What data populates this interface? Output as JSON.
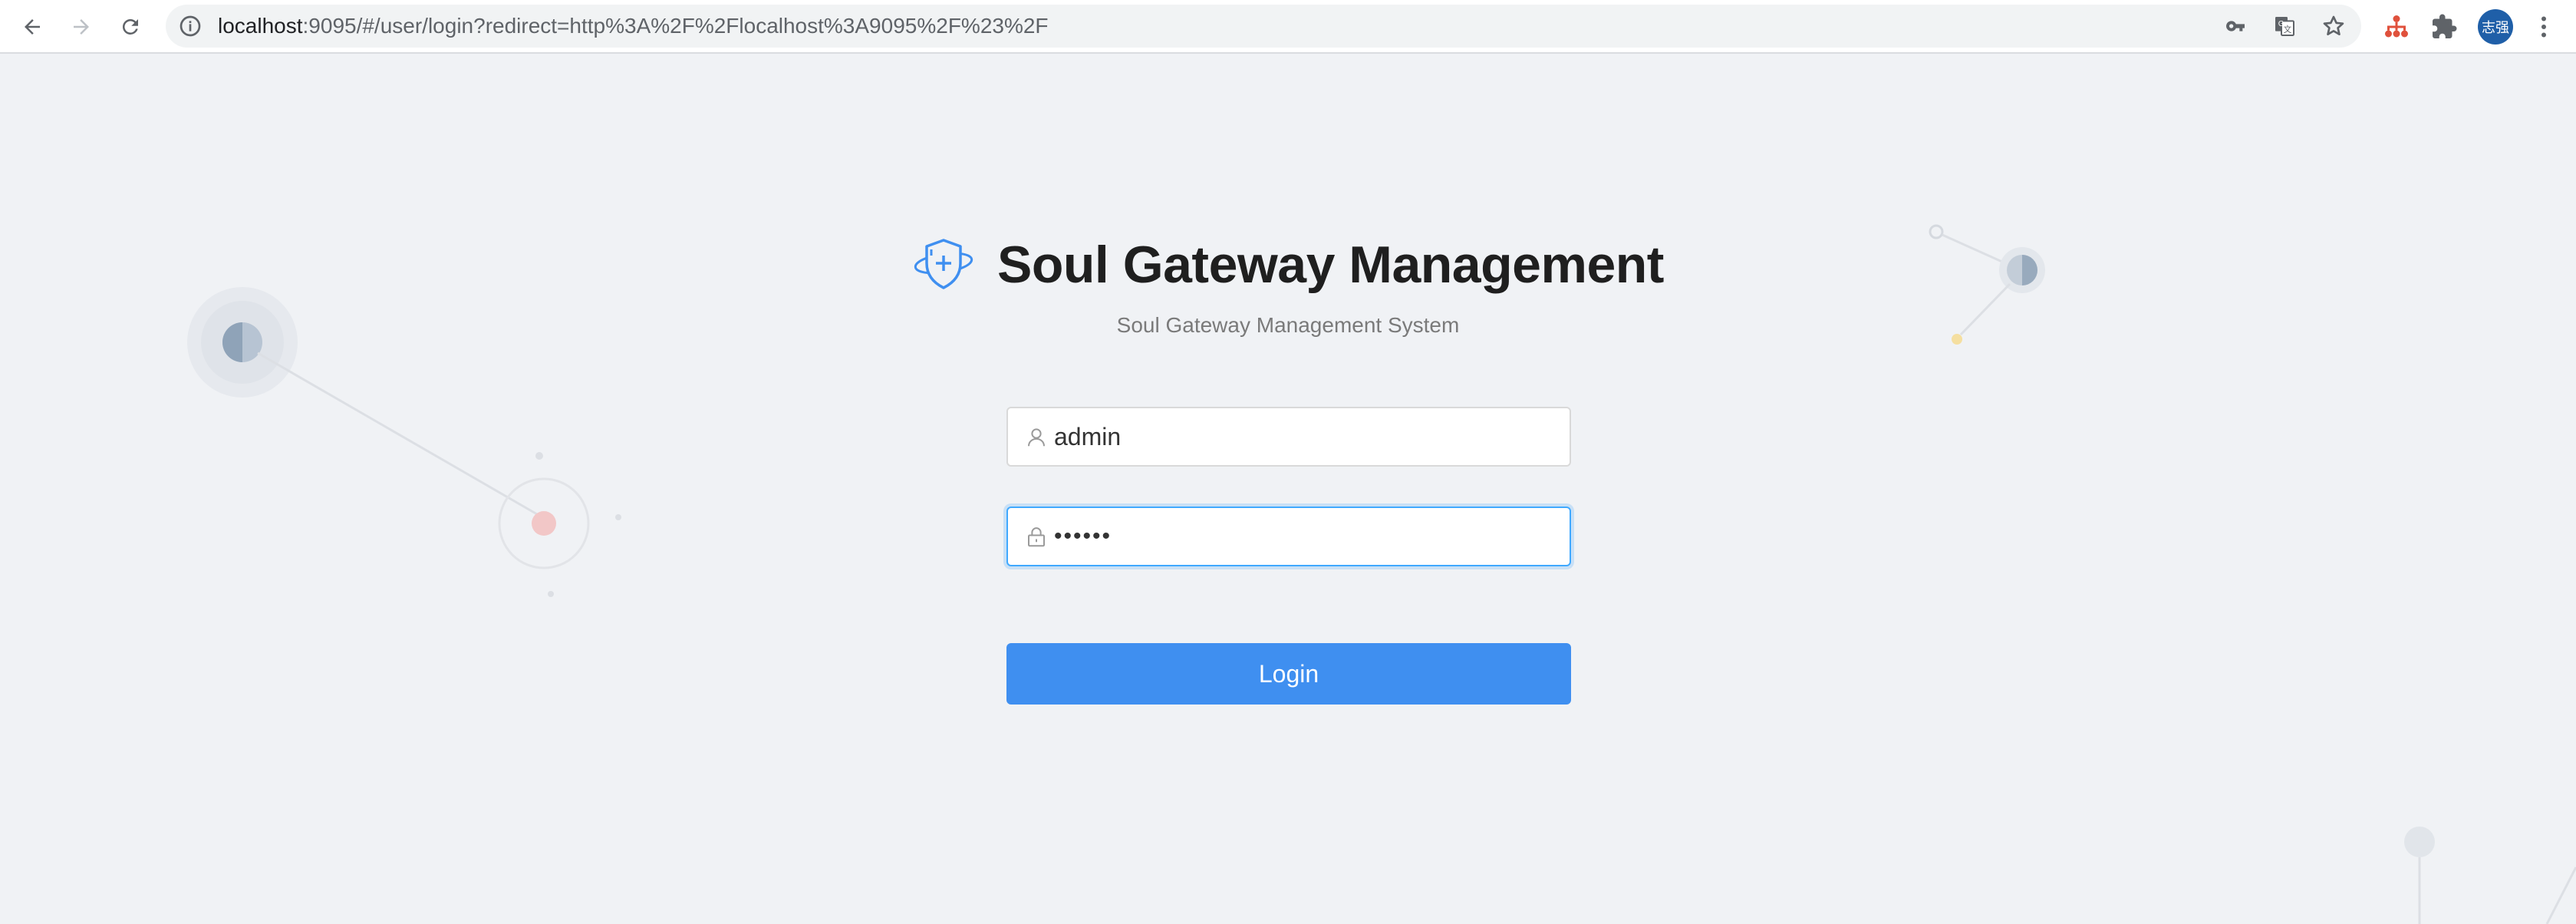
{
  "browser": {
    "url_host": "localhost",
    "url_rest": ":9095/#/user/login?redirect=http%3A%2F%2Flocalhost%3A9095%2F%23%2F",
    "avatar_text": "志强",
    "icons": [
      "back-arrow-icon",
      "forward-arrow-icon",
      "reload-icon",
      "site-info-icon",
      "key-icon",
      "translate-icon",
      "star-icon",
      "extension-hierarchy-icon",
      "puzzle-icon",
      "more-vert-icon"
    ]
  },
  "login": {
    "title": "Soul Gateway Management",
    "subtitle": "Soul Gateway Management System",
    "username_value": "admin",
    "password_value": "••••••",
    "login_label": "Login"
  },
  "colors": {
    "accent": "#3f8ff0",
    "focus_border": "#40a9ff",
    "background": "#f0f2f5"
  }
}
